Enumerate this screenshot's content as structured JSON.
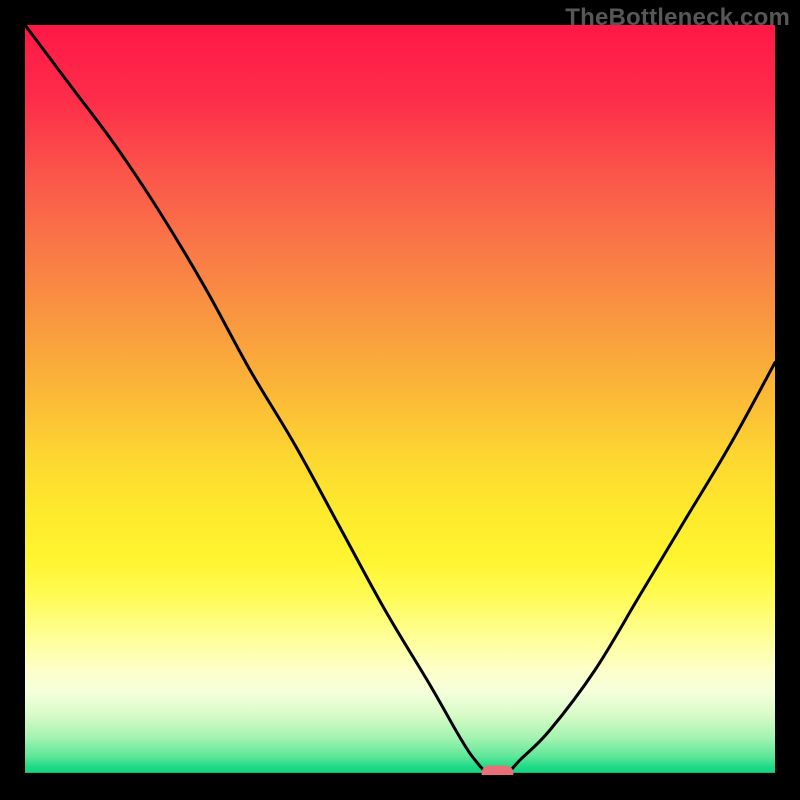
{
  "watermark": {
    "text": "TheBottleneck.com"
  },
  "colors": {
    "background": "#000000",
    "marker": "#e96f78",
    "curve": "#000000",
    "gradient_top": "#ff1846",
    "gradient_bottom": "#0dd581"
  },
  "chart_data": {
    "type": "line",
    "title": "",
    "xlabel": "",
    "ylabel": "",
    "xlim": [
      0,
      100
    ],
    "ylim": [
      0,
      100
    ],
    "grid": false,
    "legend": false,
    "series": [
      {
        "name": "bottleneck-curve",
        "x": [
          0,
          6,
          12,
          18,
          24,
          30,
          36,
          42,
          48,
          54,
          58,
          60,
          62,
          64,
          66,
          70,
          76,
          82,
          88,
          94,
          100
        ],
        "values": [
          100,
          92,
          84,
          75,
          65,
          54,
          44,
          33,
          22,
          12,
          5,
          2,
          0,
          0,
          2,
          6,
          14,
          24,
          34,
          44,
          55
        ]
      }
    ],
    "marker": {
      "x": 63,
      "y": 0,
      "shape": "pill"
    },
    "background_gradient": {
      "orientation": "vertical",
      "stops": [
        {
          "pos": 0,
          "color": "#ff1846"
        },
        {
          "pos": 50,
          "color": "#fdd830"
        },
        {
          "pos": 80,
          "color": "#feff8f"
        },
        {
          "pos": 95,
          "color": "#a5f3b0"
        },
        {
          "pos": 100,
          "color": "#0dd581"
        }
      ]
    }
  }
}
